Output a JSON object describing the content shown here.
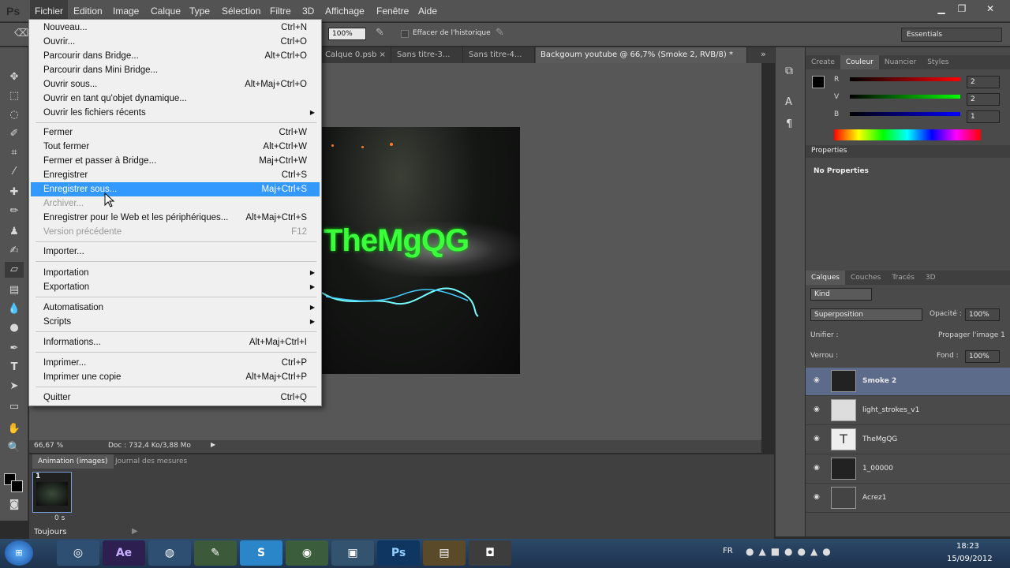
{
  "menubar": {
    "logo": "Ps",
    "items": [
      "Fichier",
      "Edition",
      "Image",
      "Calque",
      "Type",
      "Sélection",
      "Filtre",
      "3D",
      "Affichage",
      "Fenêtre",
      "Aide"
    ],
    "window_controls": [
      "minimize-icon",
      "restore-icon",
      "close-icon"
    ]
  },
  "options": {
    "zoom": "100%",
    "erase_history_label": "Effacer de l'historique",
    "workspace": "Essentials"
  },
  "tabs": [
    "Calque 0.psb",
    "Sans titre-3...",
    "Sans titre-4...",
    "Backgoum youtube @ 66,7% (Smoke 2, RVB/8) *"
  ],
  "canvas": {
    "title_text": "TheMgQG"
  },
  "status": {
    "zoom": "66,67 %",
    "doc": "Doc : 732,4 Ko/3,88 Mo"
  },
  "timeline": {
    "tabs": [
      "Animation (images)",
      "Journal des mesures"
    ],
    "frame_number": "1",
    "frame_time": "0 s",
    "loop": "Toujours"
  },
  "color_panel": {
    "tabs": [
      "Create",
      "Couleur",
      "Nuancier",
      "Styles"
    ],
    "channels": [
      {
        "label": "R",
        "value": "2"
      },
      {
        "label": "V",
        "value": "2"
      },
      {
        "label": "B",
        "value": "1"
      }
    ]
  },
  "properties_panel": {
    "title": "Properties",
    "text": "No Properties"
  },
  "layers_panel": {
    "tabs": [
      "Calques",
      "Couches",
      "Tracés",
      "3D"
    ],
    "filter": "Kind",
    "blend": "Superposition",
    "opacity_label": "Opacité :",
    "opacity": "100%",
    "unify_label": "Unifier :",
    "propagate_label": "Propager l'image 1",
    "lock_label": "Verrou :",
    "fill_label": "Fond :",
    "fill": "100%",
    "layers": [
      {
        "name": "Smoke 2",
        "selected": true
      },
      {
        "name": "light_strokes_v1",
        "selected": false
      },
      {
        "name": "TheMgQG",
        "selected": false,
        "type": "text"
      },
      {
        "name": "1_00000",
        "selected": false
      },
      {
        "name": "Acrez1",
        "selected": false
      }
    ]
  },
  "file_menu": {
    "items": [
      {
        "label": "Nouveau...",
        "shortcut": "Ctrl+N"
      },
      {
        "label": "Ouvrir...",
        "shortcut": "Ctrl+O"
      },
      {
        "label": "Parcourir dans Bridge...",
        "shortcut": "Alt+Ctrl+O"
      },
      {
        "label": "Parcourir dans Mini Bridge...",
        "shortcut": ""
      },
      {
        "label": "Ouvrir sous...",
        "shortcut": "Alt+Maj+Ctrl+O"
      },
      {
        "label": "Ouvrir en tant qu'objet dynamique...",
        "shortcut": ""
      },
      {
        "label": "Ouvrir les fichiers récents",
        "shortcut": "",
        "submenu": true
      },
      {
        "label": "Fermer",
        "shortcut": "Ctrl+W"
      },
      {
        "label": "Tout fermer",
        "shortcut": "Alt+Ctrl+W"
      },
      {
        "label": "Fermer et passer à Bridge...",
        "shortcut": "Maj+Ctrl+W"
      },
      {
        "label": "Enregistrer",
        "shortcut": "Ctrl+S"
      },
      {
        "label": "Enregistrer sous...",
        "shortcut": "Maj+Ctrl+S",
        "highlighted": true
      },
      {
        "label": "Archiver...",
        "shortcut": "",
        "disabled": true
      },
      {
        "label": "Enregistrer pour le Web et les périphériques...",
        "shortcut": "Alt+Maj+Ctrl+S"
      },
      {
        "label": "Version précédente",
        "shortcut": "F12",
        "disabled": true
      },
      {
        "label": "Importer...",
        "shortcut": ""
      },
      {
        "label": "Importation",
        "shortcut": "",
        "submenu": true
      },
      {
        "label": "Exportation",
        "shortcut": "",
        "submenu": true
      },
      {
        "label": "Automatisation",
        "shortcut": "",
        "submenu": true
      },
      {
        "label": "Scripts",
        "shortcut": "",
        "submenu": true
      },
      {
        "label": "Informations...",
        "shortcut": "Alt+Maj+Ctrl+I"
      },
      {
        "label": "Imprimer...",
        "shortcut": "Ctrl+P"
      },
      {
        "label": "Imprimer une copie",
        "shortcut": "Alt+Maj+Ctrl+P"
      },
      {
        "label": "Quitter",
        "shortcut": "Ctrl+Q"
      }
    ]
  },
  "taskbar": {
    "apps": [
      "Ae",
      "Ps"
    ],
    "lang": "FR",
    "time": "18:23",
    "date": "15/09/2012"
  }
}
